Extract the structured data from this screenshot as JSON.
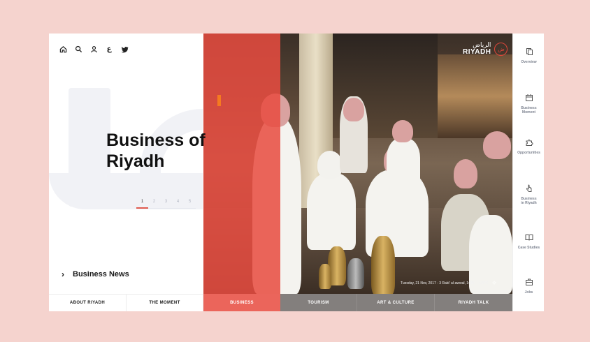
{
  "colors": {
    "background": "#f5d3ce",
    "accent": "#e84c40",
    "text": "#111111"
  },
  "top_icons": [
    "home-icon",
    "search-icon",
    "user-icon",
    "arabic-language-icon",
    "twitter-icon"
  ],
  "language_toggle": "ع",
  "hero": {
    "title": "Business of Riyadh"
  },
  "pager": [
    "1",
    "2",
    "3",
    "4",
    "5"
  ],
  "pager_active_index": 0,
  "news": {
    "label": "Business News"
  },
  "logo": {
    "arabic": "الرياض",
    "english": "RIYADH",
    "mark": "ض"
  },
  "dateline": {
    "date": "Tuesday, 21 Nov, 2017 - 3 Rabi' al-awwal, 1439",
    "temperature": "+26°C"
  },
  "bottom_nav": [
    {
      "label": "ABOUT RIYADH"
    },
    {
      "label": "THE MOMENT"
    },
    {
      "label": "BUSINESS"
    },
    {
      "label": "TOURISM"
    },
    {
      "label": "ART & CULTURE"
    },
    {
      "label": "RIYADH TALK"
    }
  ],
  "sidebar": [
    {
      "label": "Overview",
      "icon": "overview-icon"
    },
    {
      "label": "Business Moment",
      "icon": "calendar-icon"
    },
    {
      "label": "Opportunities",
      "icon": "puzzle-icon"
    },
    {
      "label": "Business in Riyadh",
      "icon": "hand-pointer-icon"
    },
    {
      "label": "Case Studies",
      "icon": "book-icon"
    },
    {
      "label": "Jobs",
      "icon": "briefcase-icon"
    }
  ]
}
